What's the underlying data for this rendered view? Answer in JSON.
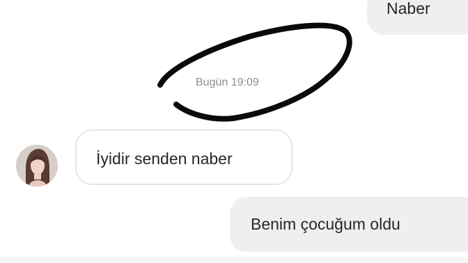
{
  "messages": [
    {
      "direction": "outgoing",
      "text": "Naber"
    },
    {
      "direction": "incoming",
      "text": "İyidir senden naber"
    },
    {
      "direction": "outgoing",
      "text": "Benim çocuğum oldu"
    }
  ],
  "timestamp": "Bugün 19:09",
  "colors": {
    "outgoing_bubble": "#efefef",
    "incoming_bubble_border": "#e6e6e6",
    "message_text": "#262626",
    "timestamp_text": "#8e8e8e",
    "scribble": "#0a0a0a"
  },
  "icons": {
    "avatar": "profile-photo"
  }
}
